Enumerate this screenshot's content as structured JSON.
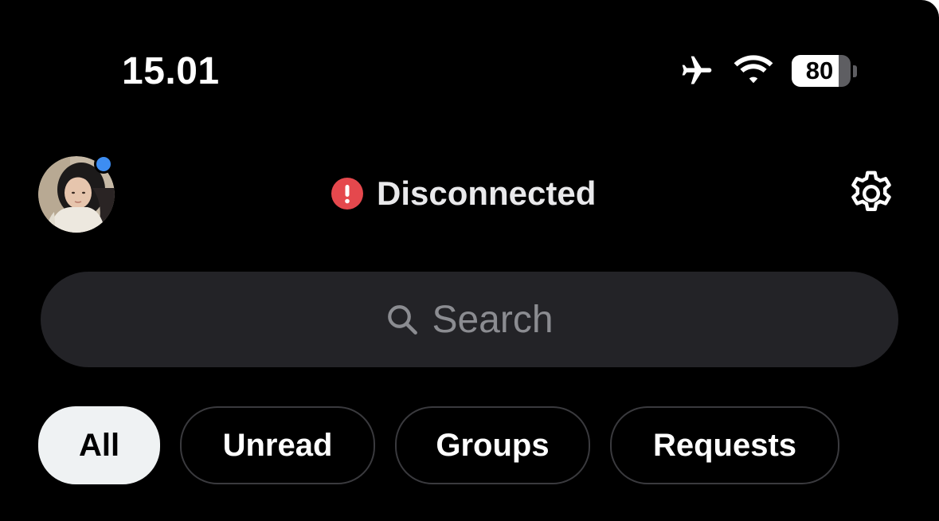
{
  "status_bar": {
    "time": "15.01",
    "battery_level": "80",
    "battery_fraction": 0.8,
    "icons": [
      "airplane-icon",
      "wifi-icon",
      "battery-icon"
    ]
  },
  "header": {
    "avatar": "profile-avatar",
    "presence_color": "#3d8df2",
    "connection_status": "Disconnected",
    "status_color": "#e5484d",
    "settings_icon": "gear-icon"
  },
  "search": {
    "placeholder": "Search"
  },
  "filters": [
    {
      "label": "All",
      "active": true
    },
    {
      "label": "Unread",
      "active": false
    },
    {
      "label": "Groups",
      "active": false
    },
    {
      "label": "Requests",
      "active": false
    }
  ]
}
